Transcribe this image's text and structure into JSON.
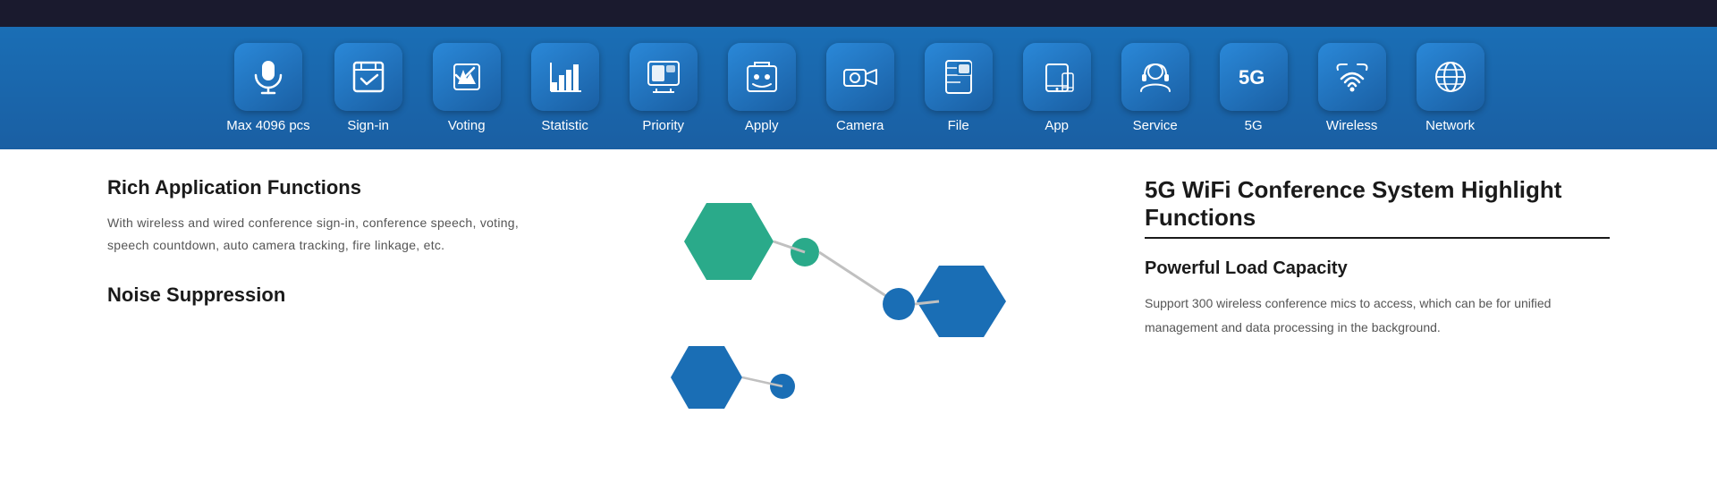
{
  "topBar": {
    "height": 30
  },
  "toolbar": {
    "items": [
      {
        "id": "max4096",
        "label": "Max 4096 pcs",
        "icon": "mic"
      },
      {
        "id": "signin",
        "label": "Sign-in",
        "icon": "signin"
      },
      {
        "id": "voting",
        "label": "Voting",
        "icon": "voting"
      },
      {
        "id": "statistic",
        "label": "Statistic",
        "icon": "statistic"
      },
      {
        "id": "priority",
        "label": "Priority",
        "icon": "priority"
      },
      {
        "id": "apply",
        "label": "Apply",
        "icon": "apply"
      },
      {
        "id": "camera",
        "label": "Camera",
        "icon": "camera"
      },
      {
        "id": "file",
        "label": "File",
        "icon": "file"
      },
      {
        "id": "app",
        "label": "App",
        "icon": "app"
      },
      {
        "id": "service",
        "label": "Service",
        "icon": "service"
      },
      {
        "id": "5g",
        "label": "5G",
        "icon": "5g"
      },
      {
        "id": "wireless",
        "label": "Wireless",
        "icon": "wireless"
      },
      {
        "id": "network",
        "label": "Network",
        "icon": "network"
      }
    ]
  },
  "content": {
    "leftSection": {
      "title1": "Rich Application Functions",
      "desc1": "With wireless and wired conference sign-in, conference speech, voting, speech countdown, auto camera tracking, fire linkage, etc.",
      "title2": "Noise Suppression"
    },
    "rightSection": {
      "mainTitle": "5G WiFi Conference System  Highlight Functions",
      "subTitle": "Powerful Load Capacity",
      "desc": "Support 300 wireless conference mics to access, which can be  for unified management and data processing in the background."
    }
  }
}
